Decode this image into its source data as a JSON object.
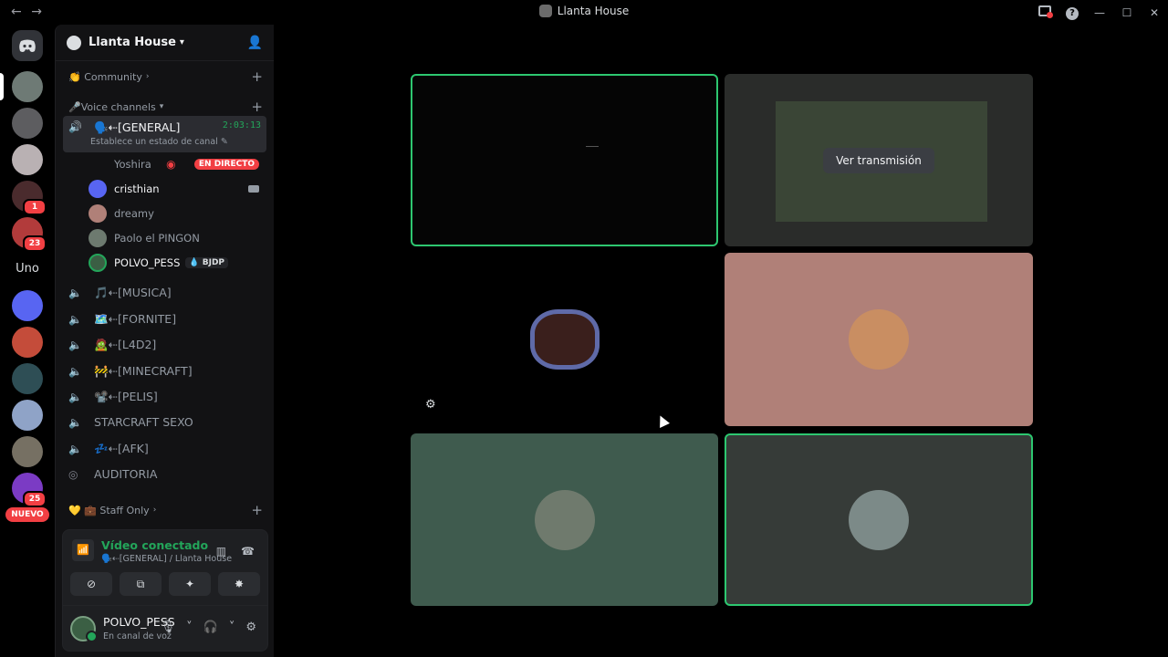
{
  "titlebar": {
    "back": "←",
    "forward": "→",
    "title": "Llanta House",
    "minimize": "—",
    "maximize": "☐",
    "close": "✕"
  },
  "guilds": {
    "badges": [
      "1",
      "23",
      "25"
    ],
    "uno_label": "Uno",
    "nuevo_label": "NUEVO"
  },
  "server": {
    "name": "Llanta House",
    "categories": {
      "community": "Community",
      "voice": "Voice channels",
      "staff": "💛 💼 Staff Only"
    },
    "active_channel": {
      "name": "🗣️⇠[GENERAL]",
      "time": "2:03:13",
      "status_hint": "Establece un estado de canal"
    },
    "voice_users": [
      {
        "name": "Yoshira",
        "live": "EN DIRECTO"
      },
      {
        "name": "cristhian"
      },
      {
        "name": "dreamy"
      },
      {
        "name": "Paolo el PINGON"
      },
      {
        "name": "POLVO_PESS",
        "tag": "💧 BJDP"
      }
    ],
    "channels": [
      "🎵⇠[MUSICA]",
      "🗺️⇠[FORNITE]",
      "🧟⇠[L4D2]",
      "🚧⇠[MINECRAFT]",
      "📽️⇠[PELIS]",
      "STARCRAFT SEXO",
      "💤⇠[AFK]",
      "AUDITORIA"
    ]
  },
  "panel": {
    "title": "Vídeo conectado",
    "subtitle": "🗣️⇠[GENERAL] / Llanta House",
    "user_name": "POLVO_PESS",
    "user_status": "En canal de voz"
  },
  "stage": {
    "watch_stream": "Ver transmisión"
  },
  "colors": {
    "accent_green": "#23a55a",
    "live_red": "#f23f43",
    "tile_pink": "#b08078",
    "tile_green": "#3f5b4e",
    "tile_dark": "#363b38"
  }
}
